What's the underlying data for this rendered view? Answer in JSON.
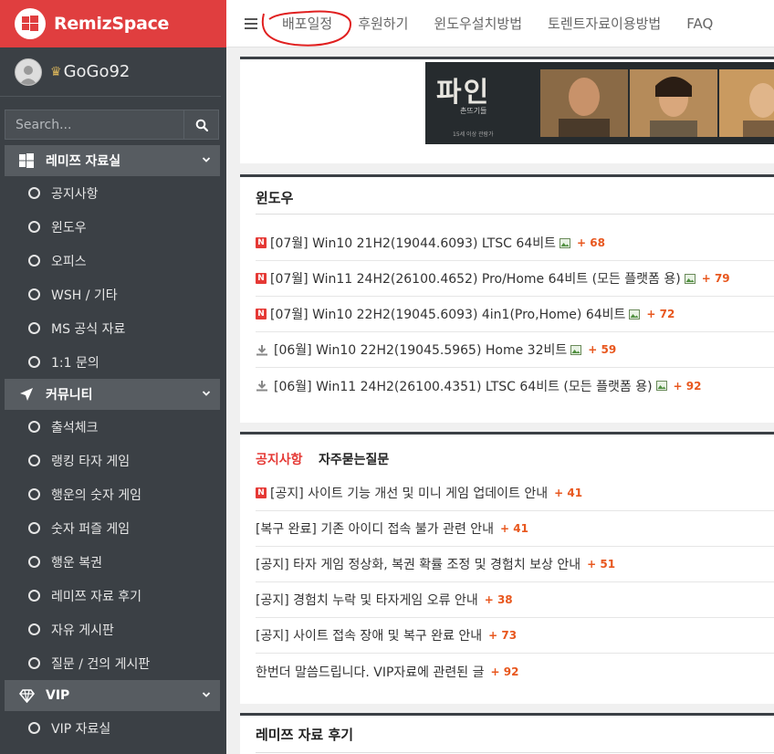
{
  "brand": {
    "name": "RemizSpace"
  },
  "user": {
    "name": "GoGo92"
  },
  "search": {
    "placeholder": "Search..."
  },
  "nav": {
    "items": [
      "배포일정",
      "후원하기",
      "윈도우설치방법",
      "토렌트자료이용방법",
      "FAQ"
    ]
  },
  "sidebar": {
    "sections": [
      {
        "label": "레미쯔 자료실",
        "icon": "windows-icon",
        "items": [
          "공지사항",
          "윈도우",
          "오피스",
          "WSH / 기타",
          "MS 공식 자료",
          "1:1 문의"
        ]
      },
      {
        "label": "커뮤니티",
        "icon": "paper-plane-icon",
        "items": [
          "출석체크",
          "랭킹 타자 게임",
          "행운의 숫자 게임",
          "숫자 퍼즐 게임",
          "행운 복권",
          "레미쯔 자료 후기",
          "자유 게시판",
          "질문 / 건의 게시판"
        ]
      },
      {
        "label": "VIP",
        "icon": "diamond-icon",
        "items": [
          "VIP 자료실"
        ]
      }
    ]
  },
  "banner": {
    "title": "파인",
    "subtitle": "촌뜨기들",
    "age": "15세 이상 관람가"
  },
  "windows_panel": {
    "title": "윈도우",
    "posts": [
      {
        "text": "[07월] Win10 21H2(19044.6093) LTSC 64비트",
        "count": "+ 68",
        "icon": "new-badge"
      },
      {
        "text": "[07월] Win11 24H2(26100.4652) Pro/Home 64비트 (모든 플랫폼 용)",
        "count": "+ 79",
        "icon": "new-badge"
      },
      {
        "text": "[07월] Win10 22H2(19045.6093) 4in1(Pro,Home) 64비트",
        "count": "+ 72",
        "icon": "new-badge"
      },
      {
        "text": "[06월] Win10 22H2(19045.5965) Home 32비트",
        "count": "+ 59",
        "icon": "download-icon"
      },
      {
        "text": "[06월] Win11 24H2(26100.4351) LTSC 64비트 (모든 플랫폼 용)",
        "count": "+ 92",
        "icon": "download-icon"
      }
    ]
  },
  "notice_panel": {
    "tabs": [
      "공지사항",
      "자주묻는질문"
    ],
    "posts": [
      {
        "text": "[공지] 사이트 기능 개선 및 미니 게임 업데이트 안내",
        "count": "+ 41",
        "new": true
      },
      {
        "text": "[복구 완료] 기존 아이디 접속 불가 관련 안내",
        "count": "+ 41",
        "new": false
      },
      {
        "text": "[공지] 타자 게임 정상화, 복권 확률 조정 및 경험치 보상 안내",
        "count": "+ 51",
        "new": false
      },
      {
        "text": "[공지] 경험치 누락 및 타자게임 오류 안내",
        "count": "+ 38",
        "new": false
      },
      {
        "text": "[공지] 사이트 접속 장애 및 복구 완료 안내",
        "count": "+ 73",
        "new": false
      },
      {
        "text": "한번더 말씀드립니다. VIP자료에 관련된 글",
        "count": "+ 92",
        "new": false
      }
    ]
  },
  "review_panel": {
    "title": "레미쯔 자료 후기"
  },
  "colors": {
    "brand_red": "#e03e3f",
    "sidebar_bg": "#3b4045",
    "count_orange": "#e8571e",
    "annotation_red": "#e02020"
  }
}
